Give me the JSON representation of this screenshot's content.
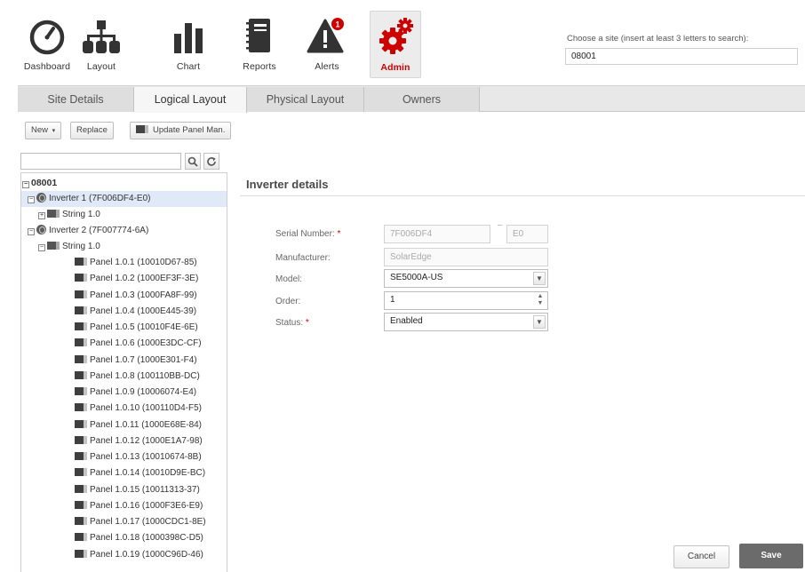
{
  "nav": {
    "items": [
      {
        "label": "Dashboard",
        "icon": "dashboard-gauge-icon"
      },
      {
        "label": "Layout",
        "icon": "layout-hierarchy-icon"
      },
      {
        "label": "Chart",
        "icon": "bar-chart-icon"
      },
      {
        "label": "Reports",
        "icon": "reports-notebook-icon"
      },
      {
        "label": "Alerts",
        "icon": "alert-triangle-icon",
        "badge": "1"
      },
      {
        "label": "Admin",
        "icon": "gears-icon",
        "active": true
      }
    ],
    "site_label": "Choose a site (insert at least 3 letters to search):",
    "site_value": "08001"
  },
  "tabs": [
    {
      "label": "Site Details"
    },
    {
      "label": "Logical Layout",
      "active": true
    },
    {
      "label": "Physical Layout"
    },
    {
      "label": "Owners"
    }
  ],
  "toolbar": {
    "new_label": "New",
    "new_caret": "▾",
    "replace_label": "Replace",
    "update_label": "Update Panel Man."
  },
  "tree": {
    "search_value": "",
    "root": "08001",
    "inverter1": "Inverter 1 (7F006DF4-E0)",
    "inverter1_string": "String 1.0",
    "inverter2": "Inverter 2 (7F007774-6A)",
    "inverter2_string": "String 1.0",
    "panels": [
      "Panel 1.0.1 (10010D67-85)",
      "Panel 1.0.2 (1000EF3F-3E)",
      "Panel 1.0.3 (1000FA8F-99)",
      "Panel 1.0.4 (1000E445-39)",
      "Panel 1.0.5 (10010F4E-6E)",
      "Panel 1.0.6 (1000E3DC-CF)",
      "Panel 1.0.7 (1000E301-F4)",
      "Panel 1.0.8 (100110BB-DC)",
      "Panel 1.0.9 (10006074-E4)",
      "Panel 1.0.10 (100110D4-F5)",
      "Panel 1.0.11 (1000E68E-84)",
      "Panel 1.0.12 (1000E1A7-98)",
      "Panel 1.0.13 (10010674-8B)",
      "Panel 1.0.14 (10010D9E-BC)",
      "Panel 1.0.15 (10011313-37)",
      "Panel 1.0.16 (1000F3E6-E9)",
      "Panel 1.0.17 (1000CDC1-8E)",
      "Panel 1.0.18 (1000398C-D5)",
      "Panel 1.0.19 (1000C96D-46)"
    ]
  },
  "details": {
    "title": "Inverter details",
    "serial_label": "Serial Number:",
    "required_mark": "*",
    "serial_value": "7F006DF4",
    "serial_dash": "–",
    "serial_suffix": "E0",
    "manufacturer_label": "Manufacturer:",
    "manufacturer_value": "SolarEdge",
    "model_label": "Model:",
    "model_value": "SE5000A-US",
    "order_label": "Order:",
    "order_value": "1",
    "status_label": "Status:",
    "status_value": "Enabled"
  },
  "buttons": {
    "cancel": "Cancel",
    "save": "Save"
  },
  "colors": {
    "accent": "#cc0000",
    "save_bg": "#6b6b6b",
    "tree_selected": "#dfe9f7"
  }
}
